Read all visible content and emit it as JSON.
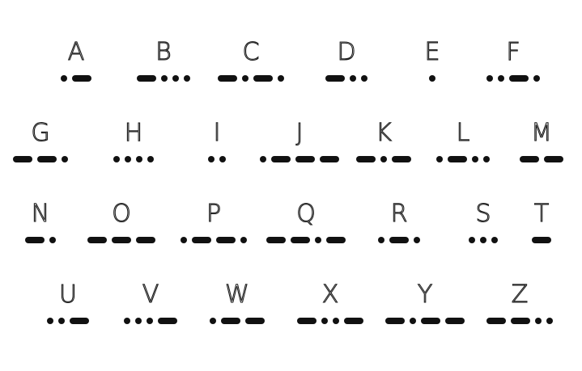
{
  "colors": {
    "background": "#ffffff",
    "ink": "#111111"
  },
  "rows": [
    [
      {
        "letter": "A",
        "code": ".-"
      },
      {
        "letter": "B",
        "code": "-..."
      },
      {
        "letter": "C",
        "code": "-.-."
      },
      {
        "letter": "D",
        "code": "-.."
      },
      {
        "letter": "E",
        "code": "."
      },
      {
        "letter": "F",
        "code": "..-."
      }
    ],
    [
      {
        "letter": "G",
        "code": "--."
      },
      {
        "letter": "H",
        "code": "...."
      },
      {
        "letter": "I",
        "code": ".."
      },
      {
        "letter": "J",
        "code": ".---"
      },
      {
        "letter": "K",
        "code": "-.-"
      },
      {
        "letter": "L",
        "code": ".-.."
      },
      {
        "letter": "M",
        "code": "--"
      }
    ],
    [
      {
        "letter": "N",
        "code": "-."
      },
      {
        "letter": "O",
        "code": "---"
      },
      {
        "letter": "P",
        "code": ".--."
      },
      {
        "letter": "Q",
        "code": "--.-"
      },
      {
        "letter": "R",
        "code": ".-."
      },
      {
        "letter": "S",
        "code": "..."
      },
      {
        "letter": "T",
        "code": "-"
      }
    ],
    [
      {
        "letter": "U",
        "code": "..-"
      },
      {
        "letter": "V",
        "code": "...-"
      },
      {
        "letter": "W",
        "code": ".--"
      },
      {
        "letter": "X",
        "code": "-..-"
      },
      {
        "letter": "Y",
        "code": "-.--"
      },
      {
        "letter": "Z",
        "code": "--.."
      }
    ]
  ]
}
